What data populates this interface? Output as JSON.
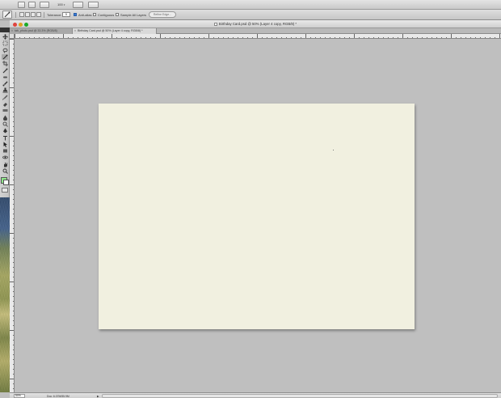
{
  "app_bar": {
    "zoom": "100",
    "icons": [
      "bridge-icon",
      "minibridge-icon",
      "arrange-icon",
      "screen-mode-icon",
      "extras-icon"
    ]
  },
  "options_bar": {
    "tolerance_label": "Tolerance:",
    "tolerance_value": "5",
    "anti_alias_label": "Anti-alias",
    "anti_alias_checked": true,
    "contiguous_label": "Contiguous",
    "contiguous_checked": false,
    "sample_all_label": "Sample All Layers",
    "sample_all_checked": false,
    "refine_edge_label": "Refine Edge..."
  },
  "document": {
    "title": "Birthday Card.psd @ 50% (Layer 4 copy, RGB/8) *",
    "tabs": [
      {
        "label": "tab_photo.psd @ 33.3% (RGB/8)",
        "active": false
      },
      {
        "label": "Birthday Card.psd @ 50% (Layer 4 copy, RGB/8) *",
        "active": true
      }
    ]
  },
  "status_bar": {
    "zoom": "50%",
    "doc_info": "Doc: 6.07M/55.9M"
  },
  "colors": {
    "foreground": "#8fe88a",
    "background": "#ffffff",
    "canvas": "#f1f0e0",
    "pasteboard": "#bfbfbf"
  }
}
